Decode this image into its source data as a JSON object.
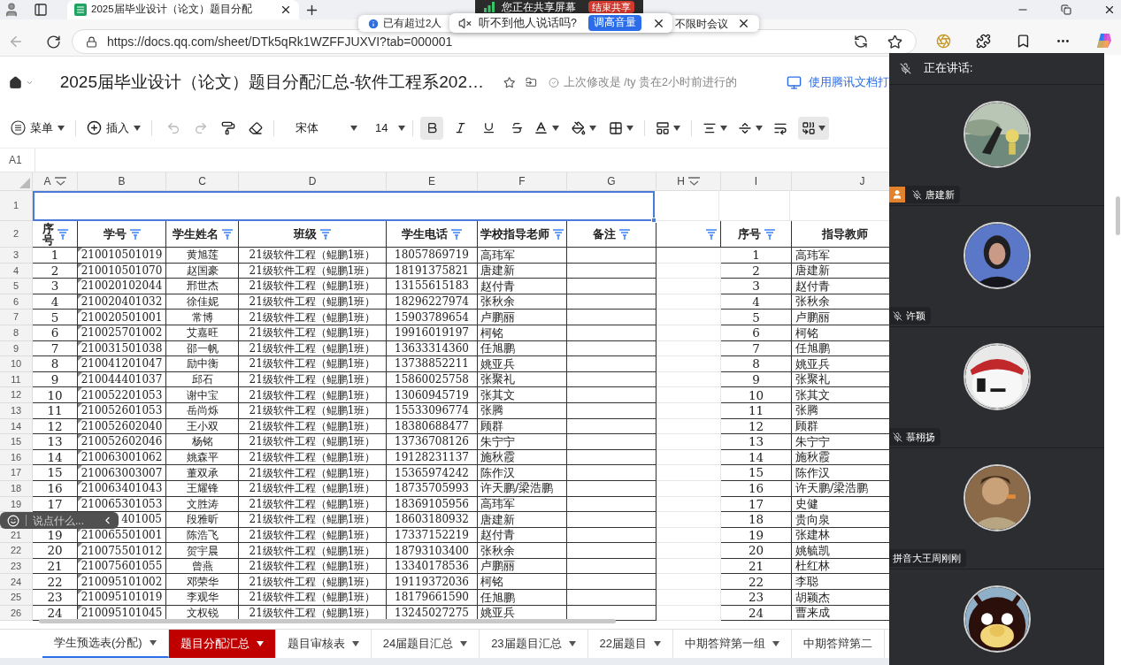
{
  "browser": {
    "tab_title": "2025届毕业设计（论文）题目分配",
    "url": "https://docs.qq.com/sheet/DTk5qRk1WZFFJUXVI?tab=000001"
  },
  "share_bar": {
    "status": "您正在共享屏幕",
    "button": "结束共享"
  },
  "notices": [
    {
      "text": "已有超过2人",
      "tail": "不限时会议"
    },
    {
      "text": "听不到他人说话吗?",
      "button": "调高音量"
    }
  ],
  "doc": {
    "title": "2025届毕业设计（论文）题目分配汇总-软件工程系202…",
    "last_modified": "上次修改是 /ty 贵在2小时前进行的",
    "open_in_app": "使用腾讯文档打"
  },
  "toolbar": {
    "menu": "菜单",
    "insert": "插入",
    "font": "宋体",
    "font_size": "14",
    "bold": true,
    "merge": true
  },
  "name_box": "A1",
  "columns": [
    {
      "label": "A",
      "filter": true
    },
    {
      "label": "B",
      "filter": false
    },
    {
      "label": "C",
      "filter": false
    },
    {
      "label": "D",
      "filter": false
    },
    {
      "label": "E",
      "filter": false
    },
    {
      "label": "F",
      "filter": false
    },
    {
      "label": "G",
      "filter": false
    },
    {
      "label": "H",
      "filter": true
    },
    {
      "label": "I",
      "filter": false
    },
    {
      "label": "J",
      "filter": false
    }
  ],
  "header_row": {
    "row": "2",
    "cells": [
      "序号",
      "学号",
      "学生姓名",
      "班级",
      "学生电话",
      "学校指导老师",
      "备注"
    ],
    "right_cells": [
      "序号",
      "指导教师"
    ]
  },
  "rows": [
    {
      "row": "3",
      "seq": "1",
      "student_id": "210010501019",
      "name": "黄旭莲",
      "class": "21级软件工程（鲲鹏1班）",
      "phone": "18057869719",
      "teacher": "高玮军",
      "seq_2": "1",
      "advisor": "高玮军"
    },
    {
      "row": "4",
      "seq": "2",
      "student_id": "210010501070",
      "name": "赵国豪",
      "class": "21级软件工程（鲲鹏1班）",
      "phone": "18191375821",
      "teacher": "唐建新",
      "seq_2": "2",
      "advisor": "唐建新"
    },
    {
      "row": "5",
      "seq": "3",
      "student_id": "210020102044",
      "name": "邢世杰",
      "class": "21级软件工程（鲲鹏1班）",
      "phone": "13155615183",
      "teacher": "赵付青",
      "seq_2": "3",
      "advisor": "赵付青"
    },
    {
      "row": "6",
      "seq": "4",
      "student_id": "210020401032",
      "name": "徐佳妮",
      "class": "21级软件工程（鲲鹏1班）",
      "phone": "18296227974",
      "teacher": "张秋余",
      "seq_2": "4",
      "advisor": "张秋余"
    },
    {
      "row": "7",
      "seq": "5",
      "student_id": "210020501001",
      "name": "常博",
      "class": "21级软件工程（鲲鹏1班）",
      "phone": "15903789654",
      "teacher": "卢鹏丽",
      "seq_2": "5",
      "advisor": "卢鹏丽"
    },
    {
      "row": "8",
      "seq": "6",
      "student_id": "210025701002",
      "name": "艾嘉旺",
      "class": "21级软件工程（鲲鹏1班）",
      "phone": "19916019197",
      "teacher": "柯铭",
      "seq_2": "6",
      "advisor": "柯铭"
    },
    {
      "row": "9",
      "seq": "7",
      "student_id": "210031501038",
      "name": "邵一帆",
      "class": "21级软件工程（鲲鹏1班）",
      "phone": "13633314360",
      "teacher": "任旭鹏",
      "seq_2": "7",
      "advisor": "任旭鹏"
    },
    {
      "row": "10",
      "seq": "8",
      "student_id": "210041201047",
      "name": "励中衡",
      "class": "21级软件工程（鲲鹏1班）",
      "phone": "13738852211",
      "teacher": "姚亚兵",
      "seq_2": "8",
      "advisor": "姚亚兵"
    },
    {
      "row": "11",
      "seq": "9",
      "student_id": "210044401037",
      "name": "邱石",
      "class": "21级软件工程（鲲鹏1班）",
      "phone": "15860025758",
      "teacher": "张聚礼",
      "seq_2": "9",
      "advisor": "张聚礼"
    },
    {
      "row": "12",
      "seq": "10",
      "student_id": "210052201053",
      "name": "谢中宝",
      "class": "21级软件工程（鲲鹏1班）",
      "phone": "13060945719",
      "teacher": "张其文",
      "seq_2": "10",
      "advisor": "张其文"
    },
    {
      "row": "13",
      "seq": "11",
      "student_id": "210052601053",
      "name": "岳尚烁",
      "class": "21级软件工程（鲲鹏1班）",
      "phone": "15533096774",
      "teacher": "张腾",
      "seq_2": "11",
      "advisor": "张腾"
    },
    {
      "row": "14",
      "seq": "12",
      "student_id": "210052602040",
      "name": "王小双",
      "class": "21级软件工程（鲲鹏1班）",
      "phone": "18380688477",
      "teacher": "顾群",
      "seq_2": "12",
      "advisor": "顾群"
    },
    {
      "row": "15",
      "seq": "13",
      "student_id": "210052602046",
      "name": "杨铭",
      "class": "21级软件工程（鲲鹏1班）",
      "phone": "13736708126",
      "teacher": "朱宁宁",
      "seq_2": "13",
      "advisor": "朱宁宁"
    },
    {
      "row": "16",
      "seq": "14",
      "student_id": "210063001062",
      "name": "姚森平",
      "class": "21级软件工程（鲲鹏1班）",
      "phone": "19128231137",
      "teacher": "施秋霞",
      "seq_2": "14",
      "advisor": "施秋霞"
    },
    {
      "row": "17",
      "seq": "15",
      "student_id": "210063003007",
      "name": "董双承",
      "class": "21级软件工程（鲲鹏1班）",
      "phone": "15365974242",
      "teacher": "陈作汉",
      "seq_2": "15",
      "advisor": "陈作汉"
    },
    {
      "row": "18",
      "seq": "16",
      "student_id": "210063401043",
      "name": "王耀锋",
      "class": "21级软件工程（鲲鹏1班）",
      "phone": "18735705993",
      "teacher": "许天鹏/梁浩鹏",
      "seq_2": "16",
      "advisor": "许天鹏/梁浩鹏"
    },
    {
      "row": "19",
      "seq": "17",
      "student_id": "210065301053",
      "name": "文胜涛",
      "class": "21级软件工程（鲲鹏1班）",
      "phone": "18369105956",
      "teacher": "高玮军",
      "seq_2": "17",
      "advisor": "史健"
    },
    {
      "student_id": "401005",
      "name": "段雅昕",
      "class": "21级软件工程（鲲鹏1班）",
      "phone": "18603180932",
      "teacher": "唐建新",
      "seq_2": "18",
      "advisor": "贵向泉"
    },
    {
      "row": "21",
      "seq": "19",
      "student_id": "210065501001",
      "name": "陈浩飞",
      "class": "21级软件工程（鲲鹏1班）",
      "phone": "17337152219",
      "teacher": "赵付青",
      "seq_2": "19",
      "advisor": "张建林"
    },
    {
      "row": "22",
      "seq": "20",
      "student_id": "210075501012",
      "name": "贺宇晨",
      "class": "21级软件工程（鲲鹏1班）",
      "phone": "18793103400",
      "teacher": "张秋余",
      "seq_2": "20",
      "advisor": "姚毓凯"
    },
    {
      "row": "23",
      "seq": "21",
      "student_id": "210075601055",
      "name": "曾燕",
      "class": "21级软件工程（鲲鹏1班）",
      "phone": "13340178536",
      "teacher": "卢鹏丽",
      "seq_2": "21",
      "advisor": "杜红林"
    },
    {
      "row": "24",
      "seq": "22",
      "student_id": "210095101002",
      "name": "邓荣华",
      "class": "21级软件工程（鲲鹏1班）",
      "phone": "19119372036",
      "teacher": "柯铭",
      "seq_2": "22",
      "advisor": "李聪"
    },
    {
      "row": "25",
      "seq": "23",
      "student_id": "210095101019",
      "name": "李观华",
      "class": "21级软件工程（鲲鹏1班）",
      "phone": "18179661590",
      "teacher": "任旭鹏",
      "seq_2": "23",
      "advisor": "胡颖杰"
    },
    {
      "row": "26",
      "seq": "24",
      "student_id": "210095101045",
      "name": "文权锐",
      "class": "21级软件工程（鲲鹏1班）",
      "phone": "13245027275",
      "teacher": "姚亚兵",
      "seq_2": "24",
      "advisor": "曹来成"
    }
  ],
  "first_row": "1",
  "sheet_tabs": [
    {
      "label": "学生预选表(分配)",
      "selected": true,
      "caret": true
    },
    {
      "label": "题目分配汇总",
      "selected": false,
      "caret": true,
      "color": "#c00000"
    },
    {
      "label": "题目审核表",
      "selected": false,
      "caret": true
    },
    {
      "label": "24届题目汇总",
      "selected": false,
      "caret": true
    },
    {
      "label": "23届题目汇总",
      "selected": false,
      "caret": true
    },
    {
      "label": "22届题目",
      "selected": false,
      "caret": true
    },
    {
      "label": "中期答辩第一组",
      "selected": false,
      "caret": true
    },
    {
      "label": "中期答辩第二",
      "selected": false,
      "caret": false
    }
  ],
  "chat_input": {
    "placeholder": "说点什么..."
  },
  "meeting": {
    "speaking_label": "正在讲话:",
    "participants": [
      {
        "kind": "picture",
        "name": "唐建新",
        "mic": true,
        "host": true
      },
      {
        "kind": "picture",
        "name": "许颖",
        "mic": true,
        "host": false
      },
      {
        "kind": "picture",
        "name": "慕栩扬",
        "mic": true,
        "host": false
      },
      {
        "kind": "picture",
        "name": "拼音大王周刚刚",
        "mic": false,
        "host": false
      },
      {
        "kind": "picture"
      }
    ]
  }
}
